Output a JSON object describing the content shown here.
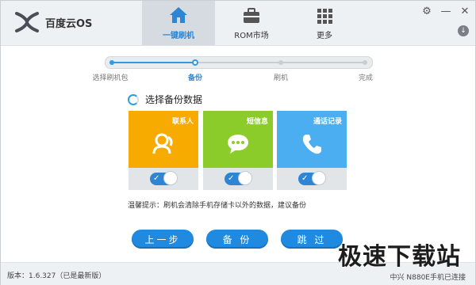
{
  "app": {
    "logo_text": "百度云OS"
  },
  "nav": {
    "tabs": [
      {
        "label": "一键刷机",
        "icon": "home-icon",
        "active": true
      },
      {
        "label": "ROM市场",
        "icon": "briefcase-icon",
        "active": false
      },
      {
        "label": "更多",
        "icon": "grid-icon",
        "active": false
      }
    ]
  },
  "window_controls": {
    "settings": "gear-icon",
    "minimize": "minimize-icon",
    "close": "close-icon",
    "download": "download-icon"
  },
  "steps": {
    "items": [
      "选择刷机包",
      "备份",
      "刷机",
      "完成"
    ],
    "current_index": 1
  },
  "section_title": "选择备份数据",
  "cards": [
    {
      "title": "联系人",
      "color": "#f7aa00",
      "icon": "contacts-icon",
      "enabled": true
    },
    {
      "title": "短信息",
      "color": "#8ccc2a",
      "icon": "message-icon",
      "enabled": true
    },
    {
      "title": "通话记录",
      "color": "#4aaef0",
      "icon": "phone-icon",
      "enabled": true
    }
  ],
  "tip": "温馨提示：刷机会清除手机存储卡以外的数据，建议备份",
  "buttons": {
    "prev": "上一步",
    "backup": "备 份",
    "skip": "跳 过"
  },
  "status": {
    "version": "版本：1.6.327（已是最新版）",
    "connection": "中兴 N880E手机已连接"
  },
  "watermark": "极速下载站",
  "colors": {
    "accent": "#2d85d4",
    "button": "#1f8ae0"
  }
}
